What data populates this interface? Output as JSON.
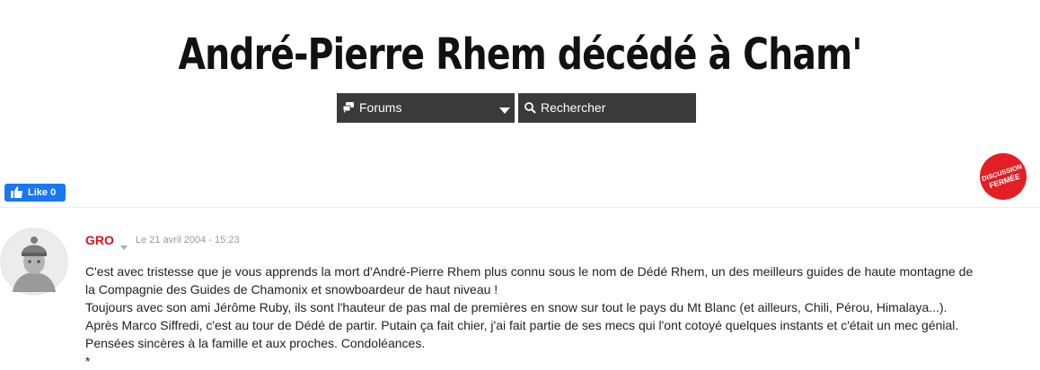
{
  "header": {
    "title": "André-Pierre Rhem décédé à Cham'"
  },
  "nav": {
    "forums_label": "Forums",
    "search_label": "Rechercher"
  },
  "like": {
    "label": "Like 0"
  },
  "status_badge": {
    "lines": [
      "DISCUSSION",
      "FERMÉE"
    ],
    "color": "#e31e24"
  },
  "post": {
    "author": "GRO",
    "date": "Le 21 avril 2004 - 15:23",
    "lines": [
      "C'est avec tristesse que je vous apprends la mort d'André-Pierre Rhem plus connu sous le nom de Dédé Rhem, un des meilleurs guides de haute montagne de",
      "la Compagnie des Guides de Chamonix et snowboardeur de haut niveau !",
      "Toujours avec son ami Jérôme Ruby, ils sont l'hauteur de pas mal de premières en snow sur tout le pays du Mt Blanc (et ailleurs, Chili, Pérou, Himalaya...).",
      "Après Marco Siffredi, c'est au tour de Dédé de partir. Putain ça fait chier, j'ai fait partie de ses mecs qui l'ont cotoyé quelques instants et c'était un mec génial.",
      "Pensées sincères à la famille et aux proches. Condoléances.",
      "*"
    ]
  },
  "colors": {
    "accent": "#d9111c",
    "nav_bg": "#3a3a3a",
    "like_bg": "#1877f2"
  },
  "icons": {
    "forums": "chat-bubbles-icon",
    "search": "magnifier-icon",
    "like": "thumbs-up-icon",
    "author_menu": "chevron-down-icon"
  }
}
